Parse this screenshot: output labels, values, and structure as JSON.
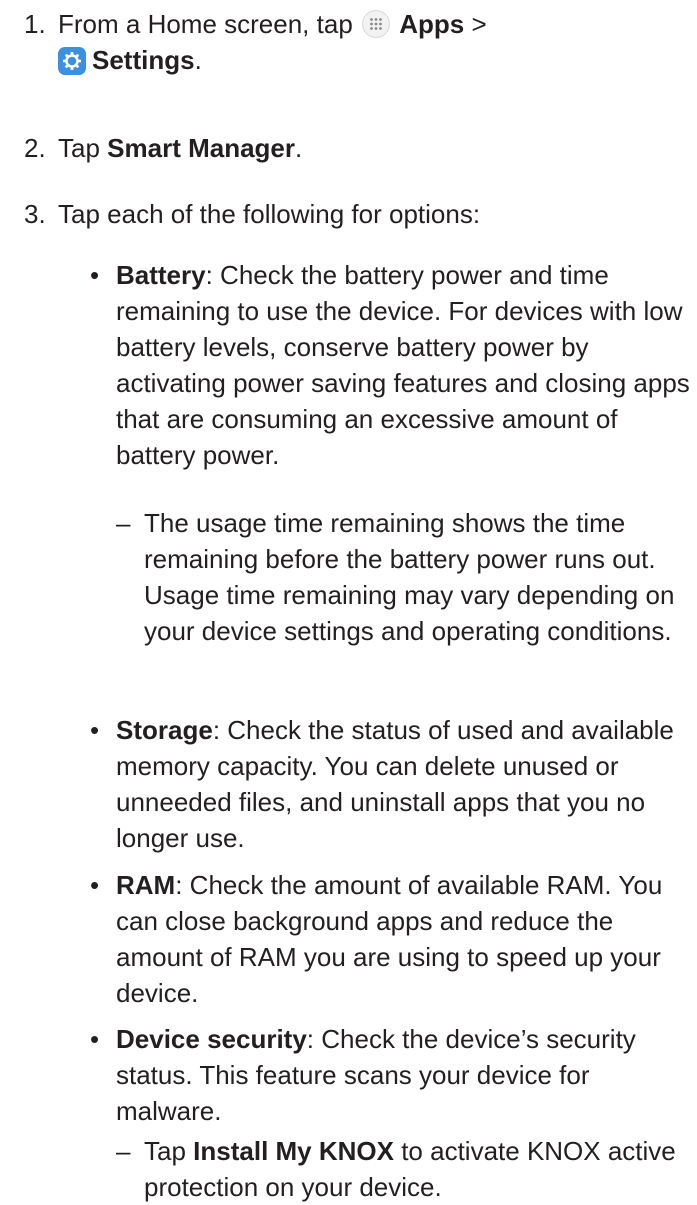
{
  "steps": [
    {
      "num": "1.",
      "pre": "From a Home screen, tap ",
      "apps_label": "Apps",
      "sep": " >",
      "settings_label": "Settings",
      "post": "."
    },
    {
      "num": "2.",
      "pre": "Tap ",
      "bold": "Smart Manager",
      "post": "."
    },
    {
      "num": "3.",
      "text": "Tap each of the following for options:"
    }
  ],
  "options": [
    {
      "title": "Battery",
      "text": ": Check the battery power and time remaining to use the device. For devices with low battery levels, conserve battery power by activating power saving features and closing apps that are consuming an excessive amount of battery power.",
      "note": "The usage time remaining shows the time remaining before the battery power runs out. Usage time remaining may vary depending on your device settings and operating conditions."
    },
    {
      "title": "Storage",
      "text": ": Check the status of used and available memory capacity. You can delete unused or unneeded files, and uninstall apps that you no longer use."
    },
    {
      "title": "RAM",
      "text": ": Check the amount of available RAM. You can close background apps and reduce the amount of RAM you are using to speed up your device."
    },
    {
      "title": "Device security",
      "text": ": Check the device’s security status. This feature scans your device for malware.",
      "note_pre": "Tap ",
      "note_bold": "Install My KNOX",
      "note_post": " to activate KNOX active protection on your device."
    }
  ],
  "icons": {
    "apps": "apps-grid-icon",
    "settings": "settings-gear-icon",
    "settings_color": "#3d8fe0"
  },
  "marks": {
    "bullet": "•",
    "dash": "–"
  }
}
